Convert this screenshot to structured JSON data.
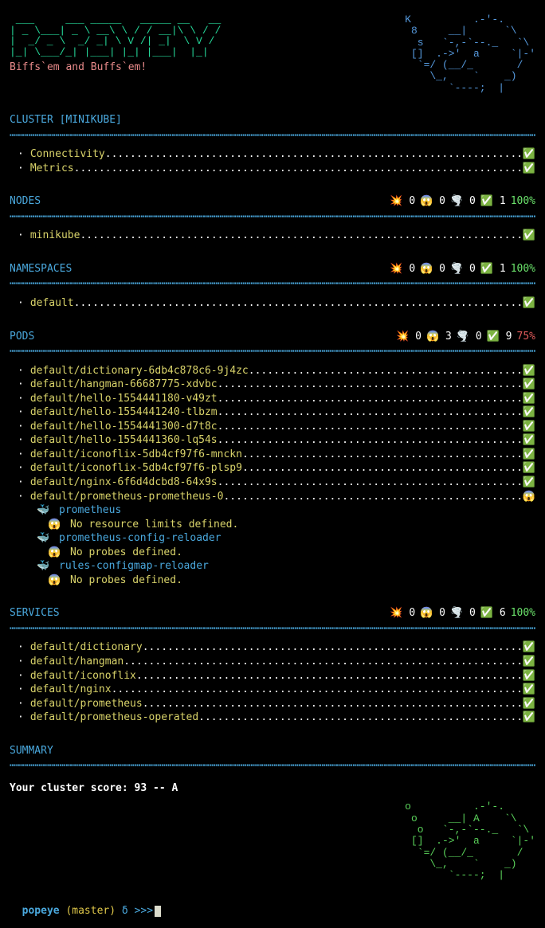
{
  "logo_ascii": " ___     ___ _____   _____ __   __\n| _ \\___| _ \\ __\\ \\ / / __|\\ \\ / /\n|  _/ _ \\  _/ _| \\ V /| _|  \\ V /\n|_| \\___/_| |___| |_| |___|  |_|",
  "tagline": "  Biffs`em and Buffs`em!",
  "k8s_ascii": "          K          .-'-.     \n           8     __|      `\\  \n            s   `-,-`--._   `\\\n           []  .->'  a     `|-'\n            `=/ (__/_       /  \n              \\_,    `    _)   \n                 `----;  |     ",
  "hr_line": "┅┅┅┅┅┅┅┅┅┅┅┅┅┅┅┅┅┅┅┅┅┅┅┅┅┅┅┅┅┅┅┅┅┅┅┅┅┅┅┅┅┅┅┅┅┅┅┅┅┅┅┅┅┅┅┅┅┅┅┅┅┅┅┅┅┅┅┅┅┅┅┅┅┅┅┅┅┅┅┅┅┅┅┅┅┅┅┅┅┅┅",
  "dots": "................................................................................................................................",
  "sections": {
    "cluster": {
      "heading": "CLUSTER [MINIKUBE]",
      "items": [
        {
          "name": "Connectivity",
          "status": "✅"
        },
        {
          "name": "Metrics",
          "status": "✅"
        }
      ]
    },
    "nodes": {
      "heading": "NODES",
      "stats": {
        "boom": 0,
        "shock": 0,
        "cloud": 0,
        "ok": 1,
        "pct": "100%",
        "pct_class": "pct-g"
      },
      "items": [
        {
          "name": "minikube",
          "status": "✅"
        }
      ]
    },
    "namespaces": {
      "heading": "NAMESPACES",
      "stats": {
        "boom": 0,
        "shock": 0,
        "cloud": 0,
        "ok": 1,
        "pct": "100%",
        "pct_class": "pct-g"
      },
      "items": [
        {
          "name": "default",
          "status": "✅"
        }
      ]
    },
    "pods": {
      "heading": "PODS",
      "stats": {
        "boom": 0,
        "shock": 3,
        "cloud": 0,
        "ok": 9,
        "pct": "75%",
        "pct_class": "pct-r"
      },
      "items": [
        {
          "name": "default/dictionary-6db4c878c6-9j4zc",
          "status": "✅"
        },
        {
          "name": "default/hangman-66687775-xdvbc",
          "status": "✅"
        },
        {
          "name": "default/hello-1554441180-v49zt",
          "status": "✅"
        },
        {
          "name": "default/hello-1554441240-tlbzm",
          "status": "✅"
        },
        {
          "name": "default/hello-1554441300-d7t8c",
          "status": "✅"
        },
        {
          "name": "default/hello-1554441360-lq54s",
          "status": "✅"
        },
        {
          "name": "default/iconoflix-5db4cf97f6-mnckn",
          "status": "✅"
        },
        {
          "name": "default/iconoflix-5db4cf97f6-plsp9",
          "status": "✅"
        },
        {
          "name": "default/nginx-6f6d4dcbd8-64x9s",
          "status": "✅"
        },
        {
          "name": "default/prometheus-prometheus-0",
          "status": "😱",
          "subs": [
            {
              "whale": "prometheus",
              "warn": "No resource limits defined."
            },
            {
              "whale": "prometheus-config-reloader",
              "warn": "No probes defined."
            },
            {
              "whale": "rules-configmap-reloader",
              "warn": "No probes defined."
            }
          ]
        }
      ]
    },
    "services": {
      "heading": "SERVICES",
      "stats": {
        "boom": 0,
        "shock": 0,
        "cloud": 0,
        "ok": 6,
        "pct": "100%",
        "pct_class": "pct-g"
      },
      "items": [
        {
          "name": "default/dictionary",
          "status": "✅"
        },
        {
          "name": "default/hangman",
          "status": "✅"
        },
        {
          "name": "default/iconoflix",
          "status": "✅"
        },
        {
          "name": "default/nginx",
          "status": "✅"
        },
        {
          "name": "default/prometheus",
          "status": "✅"
        },
        {
          "name": "default/prometheus-operated",
          "status": "✅"
        }
      ]
    }
  },
  "summary": {
    "heading": "SUMMARY",
    "score_line": "Your cluster score: 93 -- A",
    "grade_ascii": "                                o          .-'-.     \n                                 o     __| A    `\\  \n                                  o   `-,-`--._   `\\\n                                 []  .->'  a     `|-'\n                                  `=/ (__/_       /  \n                                    \\_,    `    _)   \n                                       `----;  |     "
  },
  "prompt": {
    "dir": "popeye",
    "branch": "(master)",
    "delta": "δ",
    "arrows": ">>>"
  },
  "icons": {
    "boom": "💥",
    "shock": "😱",
    "cloud": "🌪️",
    "ok": "✅",
    "whale": "🐳"
  }
}
